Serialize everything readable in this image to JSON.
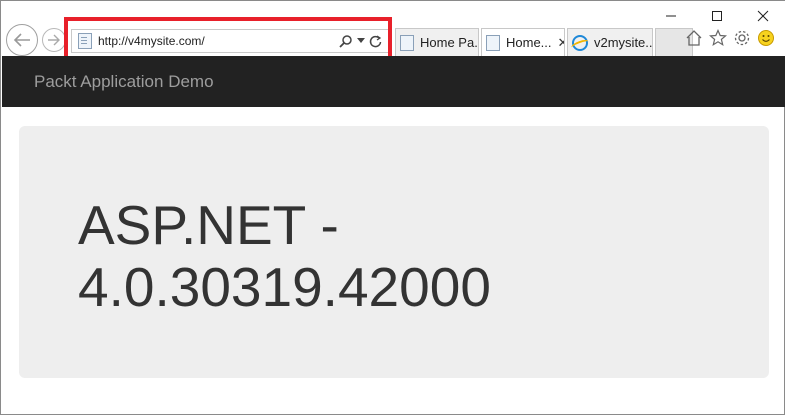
{
  "window": {
    "controls": {
      "minimize": "—",
      "maximize": "☐",
      "close": "✕"
    }
  },
  "address_bar": {
    "url": "http://v4mysite.com/"
  },
  "tabs": [
    {
      "label": "Home Pa...",
      "active": false
    },
    {
      "label": "Home...",
      "active": true,
      "close": "✕"
    },
    {
      "label": "v2mysite...",
      "active": false
    }
  ],
  "navbar": {
    "brand": "Packt Application Demo"
  },
  "jumbotron": {
    "title_line1": "ASP.NET -",
    "title_line2": "4.0.30319.42000"
  },
  "colors": {
    "highlight": "#e8202a",
    "navbar_bg": "#222222",
    "jumbotron_bg": "#eeeeee"
  }
}
